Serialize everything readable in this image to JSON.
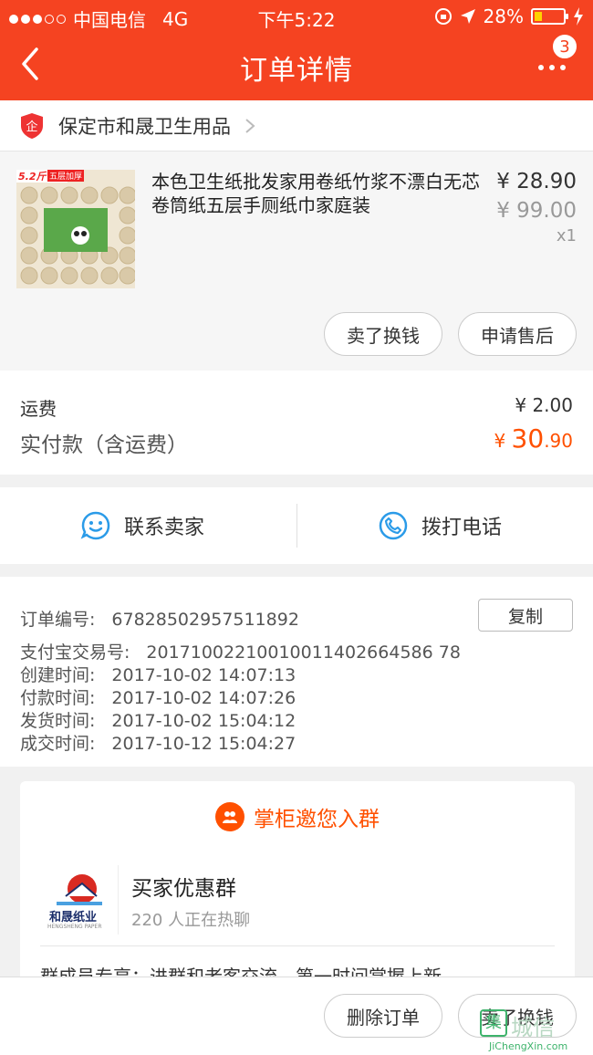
{
  "status_bar": {
    "carrier": "中国电信",
    "network": "4G",
    "time": "下午5:22",
    "battery": "28%",
    "battery_level": 0.28
  },
  "nav": {
    "title": "订单详情",
    "badge": "3"
  },
  "shop": {
    "name": "保定市和晟卫生用品"
  },
  "product": {
    "title": "本色卫生纸批发家用卷纸竹浆不漂白无芯卷筒纸五层手厕纸巾家庭装",
    "price": "¥ 28.90",
    "original_price": "¥ 99.00",
    "quantity": "x1",
    "image_badge": "5.2斤",
    "image_badge2": "五层加厚",
    "buttons": {
      "sell": "卖了换钱",
      "after_sale": "申请售后"
    }
  },
  "fees": {
    "shipping_label": "运费",
    "shipping_value": "¥ 2.00",
    "paid_label": "实付款（含运费）",
    "paid_currency": "¥ ",
    "paid_int": "30",
    "paid_dec": ".90"
  },
  "contact": {
    "seller": "联系卖家",
    "call": "拨打电话"
  },
  "order_info": {
    "copy": "复制",
    "rows": [
      {
        "key": "订单编号:",
        "value": "67828502957511892"
      },
      {
        "key": "支付宝交易号:",
        "value": "20171002210010011402664586 78"
      },
      {
        "key": "创建时间:",
        "value": "2017-10-02 14:07:13"
      },
      {
        "key": "付款时间:",
        "value": "2017-10-02 14:07:26"
      },
      {
        "key": "发货时间:",
        "value": "2017-10-02 15:04:12"
      },
      {
        "key": "成交时间:",
        "value": "2017-10-12 15:04:27"
      }
    ]
  },
  "group": {
    "header": "掌柜邀您入群",
    "name": "买家优惠群",
    "count": "220 人正在热聊",
    "logo_text": "和晟纸业",
    "logo_sub": "HENGSHENG PAPER",
    "desc": "群成员专享：进群和老客交流，第一时间掌握上新"
  },
  "bottom": {
    "delete": "删除订单",
    "sell": "卖了换钱"
  },
  "watermark": {
    "mark": "集",
    "text": "城信",
    "url": "JiChengXin.com"
  }
}
